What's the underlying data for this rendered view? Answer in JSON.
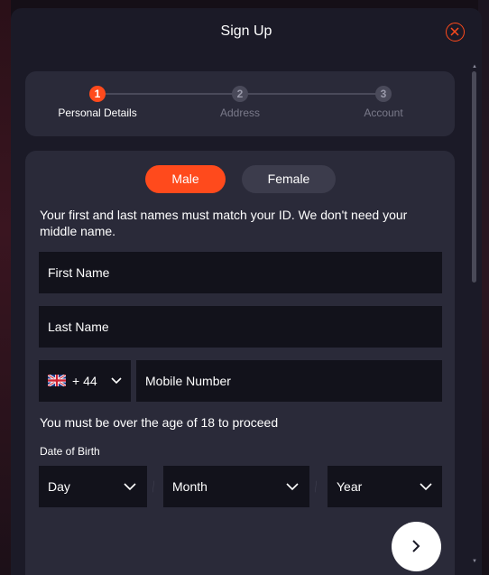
{
  "modal": {
    "title": "Sign Up"
  },
  "stepper": {
    "steps": [
      {
        "number": "1",
        "label": "Personal Details",
        "active": true
      },
      {
        "number": "2",
        "label": "Address",
        "active": false
      },
      {
        "number": "3",
        "label": "Account",
        "active": false
      }
    ]
  },
  "gender": {
    "male_label": "Male",
    "female_label": "Female",
    "selected": "Male"
  },
  "form": {
    "name_info": "Your first and last names must match your ID. We don't need your middle name.",
    "first_name_placeholder": "First Name",
    "last_name_placeholder": "Last Name",
    "phone_code": "+ 44",
    "phone_flag": "uk-flag-icon",
    "mobile_placeholder": "Mobile Number",
    "age_notice": "You must be over the age of 18 to proceed",
    "dob_label": "Date of Birth",
    "day_placeholder": "Day",
    "month_placeholder": "Month",
    "year_placeholder": "Year"
  },
  "colors": {
    "accent": "#ff4a1c",
    "modal_bg": "#1b1a27",
    "card_bg": "#2a2a39",
    "field_bg": "#12121b"
  }
}
